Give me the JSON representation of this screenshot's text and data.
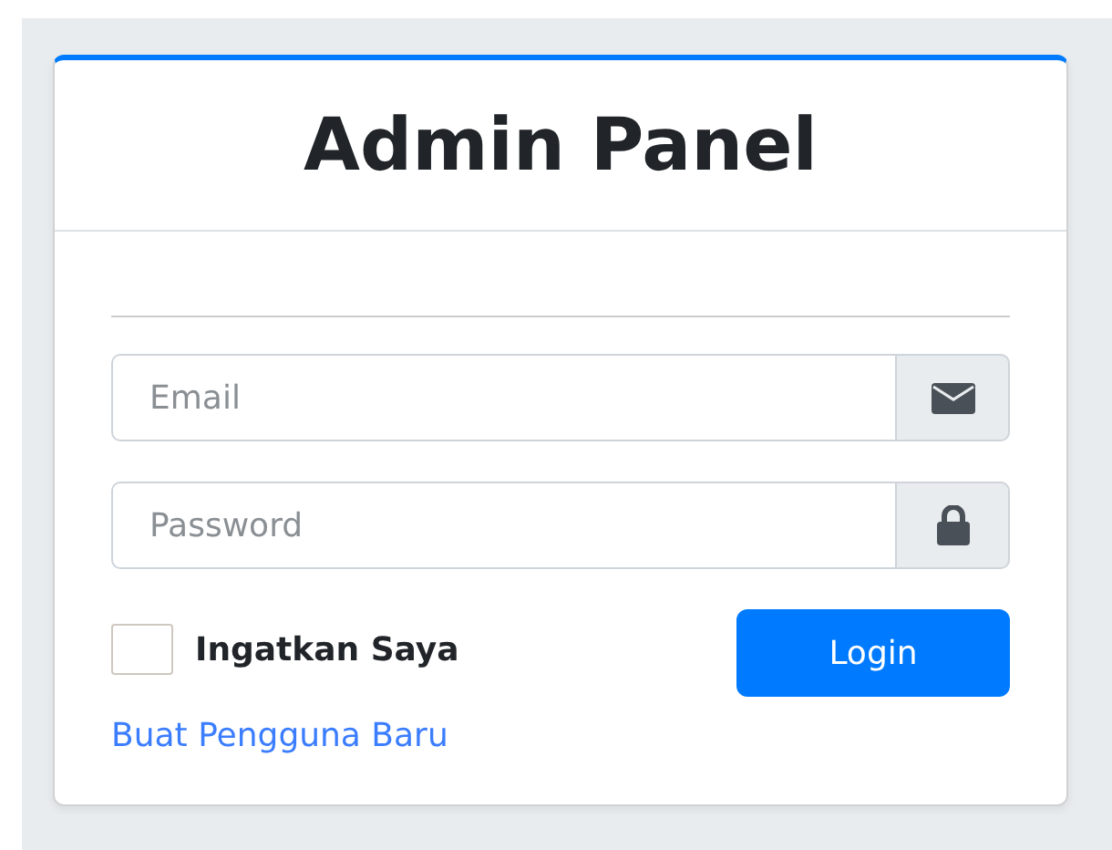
{
  "title": "Admin Panel",
  "fields": [
    {
      "kind": "email",
      "placeholder": "Email"
    },
    {
      "kind": "password",
      "placeholder": "Password"
    }
  ],
  "remember": {
    "label": "Ingatkan Saya",
    "checked": false
  },
  "login_button": "Login",
  "register_link": "Buat Pengguna Baru"
}
